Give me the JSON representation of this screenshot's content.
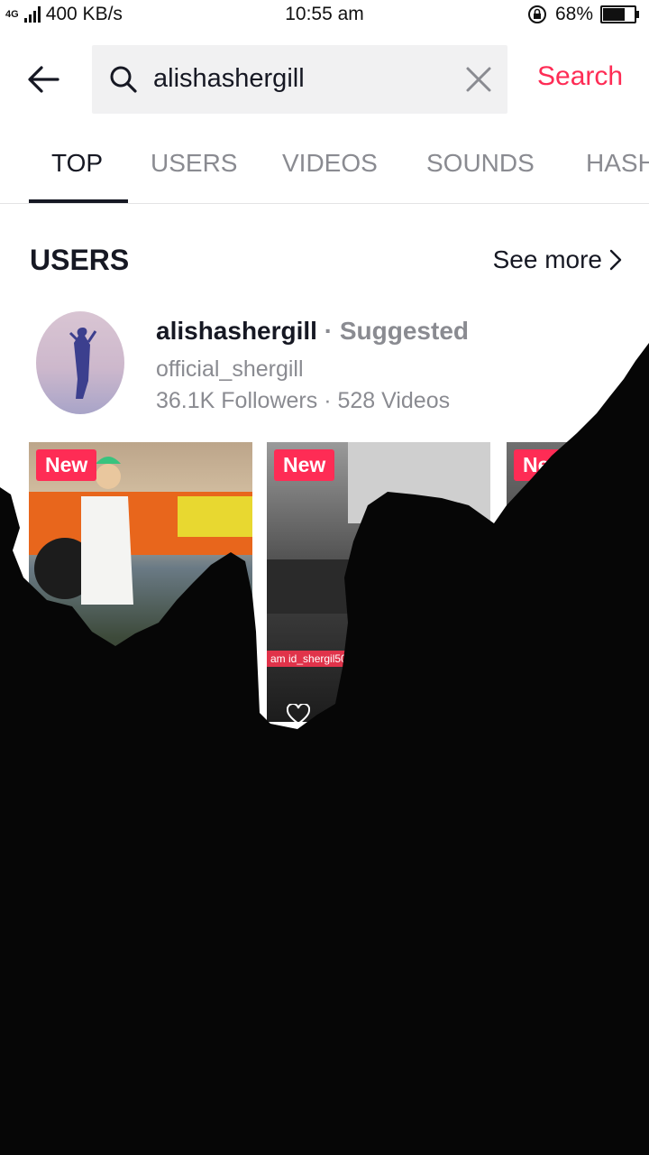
{
  "status_bar": {
    "network": "4G",
    "speed": "400 KB/s",
    "time": "10:55 am",
    "battery": "68%",
    "battery_level": 0.68
  },
  "search": {
    "query": "alishashergill",
    "button_label": "Search"
  },
  "tabs": [
    "TOP",
    "USERS",
    "VIDEOS",
    "SOUNDS",
    "HASH"
  ],
  "active_tab": "TOP",
  "users_section": {
    "title": "USERS",
    "see_more": "See more"
  },
  "user": {
    "name": "alishashergill",
    "separator": "·",
    "tag": "Suggested",
    "handle": "official_shergill",
    "stats": "36.1K Followers · 528 Videos"
  },
  "videos": [
    {
      "badge": "New",
      "caption": ""
    },
    {
      "badge": "New",
      "caption": "am id_shergil50"
    },
    {
      "badge": "New",
      "caption": ""
    }
  ],
  "colors": {
    "accent": "#fe2c55",
    "text_primary": "#161823",
    "text_secondary": "#8a8b91",
    "search_bg": "#f1f1f2"
  }
}
